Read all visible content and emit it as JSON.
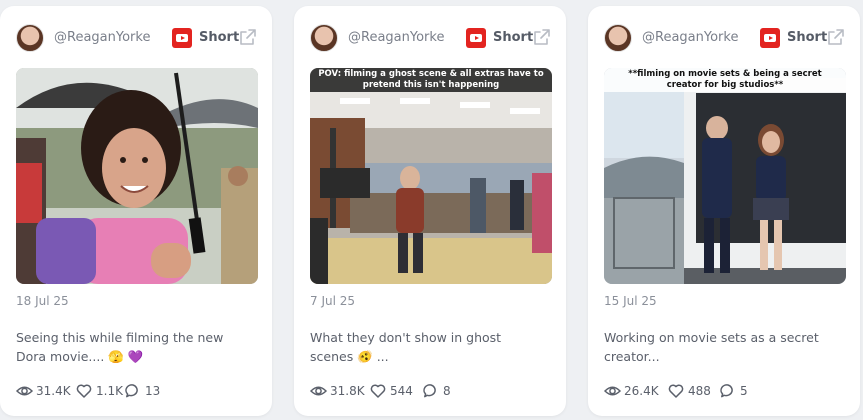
{
  "cards": [
    {
      "handle": "@ReaganYorke",
      "type_label": "Short",
      "overlay_text": "",
      "date": "18 Jul 25",
      "caption": "Seeing this while filming the new Dora movie.... 🫣 💜",
      "views": "31.4K",
      "likes": "1.1K",
      "comments": "13"
    },
    {
      "handle": "@ReaganYorke",
      "type_label": "Short",
      "overlay_text": "POV: filming a ghost scene & all extras have to pretend this isn't happening",
      "date": "7 Jul 25",
      "caption": "What they don't show in ghost scenes 🫨 ...",
      "views": "31.8K",
      "likes": "544",
      "comments": "8"
    },
    {
      "handle": "@ReaganYorke",
      "type_label": "Short",
      "overlay_text": "**filming on movie sets & being a secret creator for big studios**",
      "date": "15 Jul 25",
      "caption": "Working on movie sets as a secret creator...",
      "views": "26.4K",
      "likes": "488",
      "comments": "5"
    }
  ],
  "colors": {
    "youtube_red": "#e32420",
    "card_bg": "#ffffff",
    "page_bg": "#eef0f3"
  },
  "icons": [
    "avatar",
    "youtube-icon",
    "external-link-icon",
    "eye-icon",
    "heart-icon",
    "comment-icon"
  ]
}
